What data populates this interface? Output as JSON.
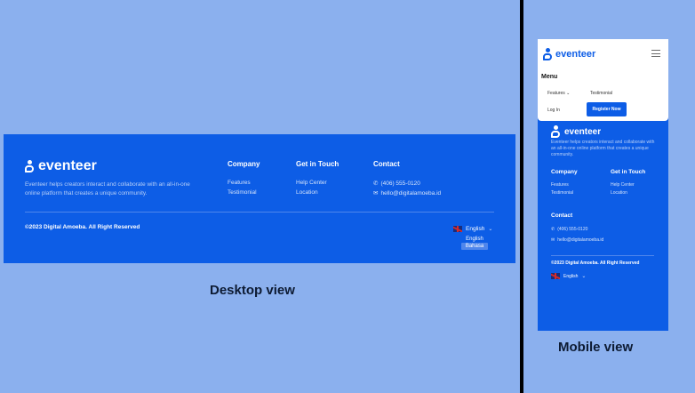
{
  "brand": {
    "name": "eventeer"
  },
  "desktop": {
    "description": "Eventeer helps creators interact and collaborate with an all-in-one online platform that creates a unique community.",
    "company": {
      "title": "Company",
      "links": [
        "Features",
        "Testimonial"
      ]
    },
    "touch": {
      "title": "Get in Touch",
      "links": [
        "Help Center",
        "Location"
      ]
    },
    "contact": {
      "title": "Contact",
      "phone": "(406) 555-0120",
      "email": "hello@digitalamoeba.id"
    },
    "copyright": "©2023 Digital Amoeba. All Right Reserved",
    "language": {
      "selected": "English",
      "options": [
        "English",
        "Bahasa"
      ]
    },
    "caption": "Desktop view"
  },
  "mobile": {
    "menu_title": "Menu",
    "menu_items": {
      "features": "Features",
      "testimonial": "Testimonial",
      "login": "Log In",
      "register": "Register Now"
    },
    "description": "Eventeer helps creators interact and collaborate with an all-in-one online platform that creates a unique community.",
    "company": {
      "title": "Company",
      "links": [
        "Features",
        "Testimonial"
      ]
    },
    "touch": {
      "title": "Get in Touch",
      "links": [
        "Help Center",
        "Location"
      ]
    },
    "contact": {
      "title": "Contact",
      "phone": "(406) 555-0120",
      "email": "hello@digitalamoeba.id"
    },
    "copyright": "©2023 Digital Amoeba. All Right Reserved",
    "language": "English",
    "caption": "Mobile view"
  },
  "icons": {
    "phone": "phone-icon",
    "email": "email-icon",
    "flag": "uk-flag-icon",
    "chevron": "chevron-down-icon",
    "menu": "hamburger-menu-icon"
  },
  "colors": {
    "brand_blue": "#0d5de6",
    "background": "#8bb0ee",
    "separator": "#000000"
  }
}
